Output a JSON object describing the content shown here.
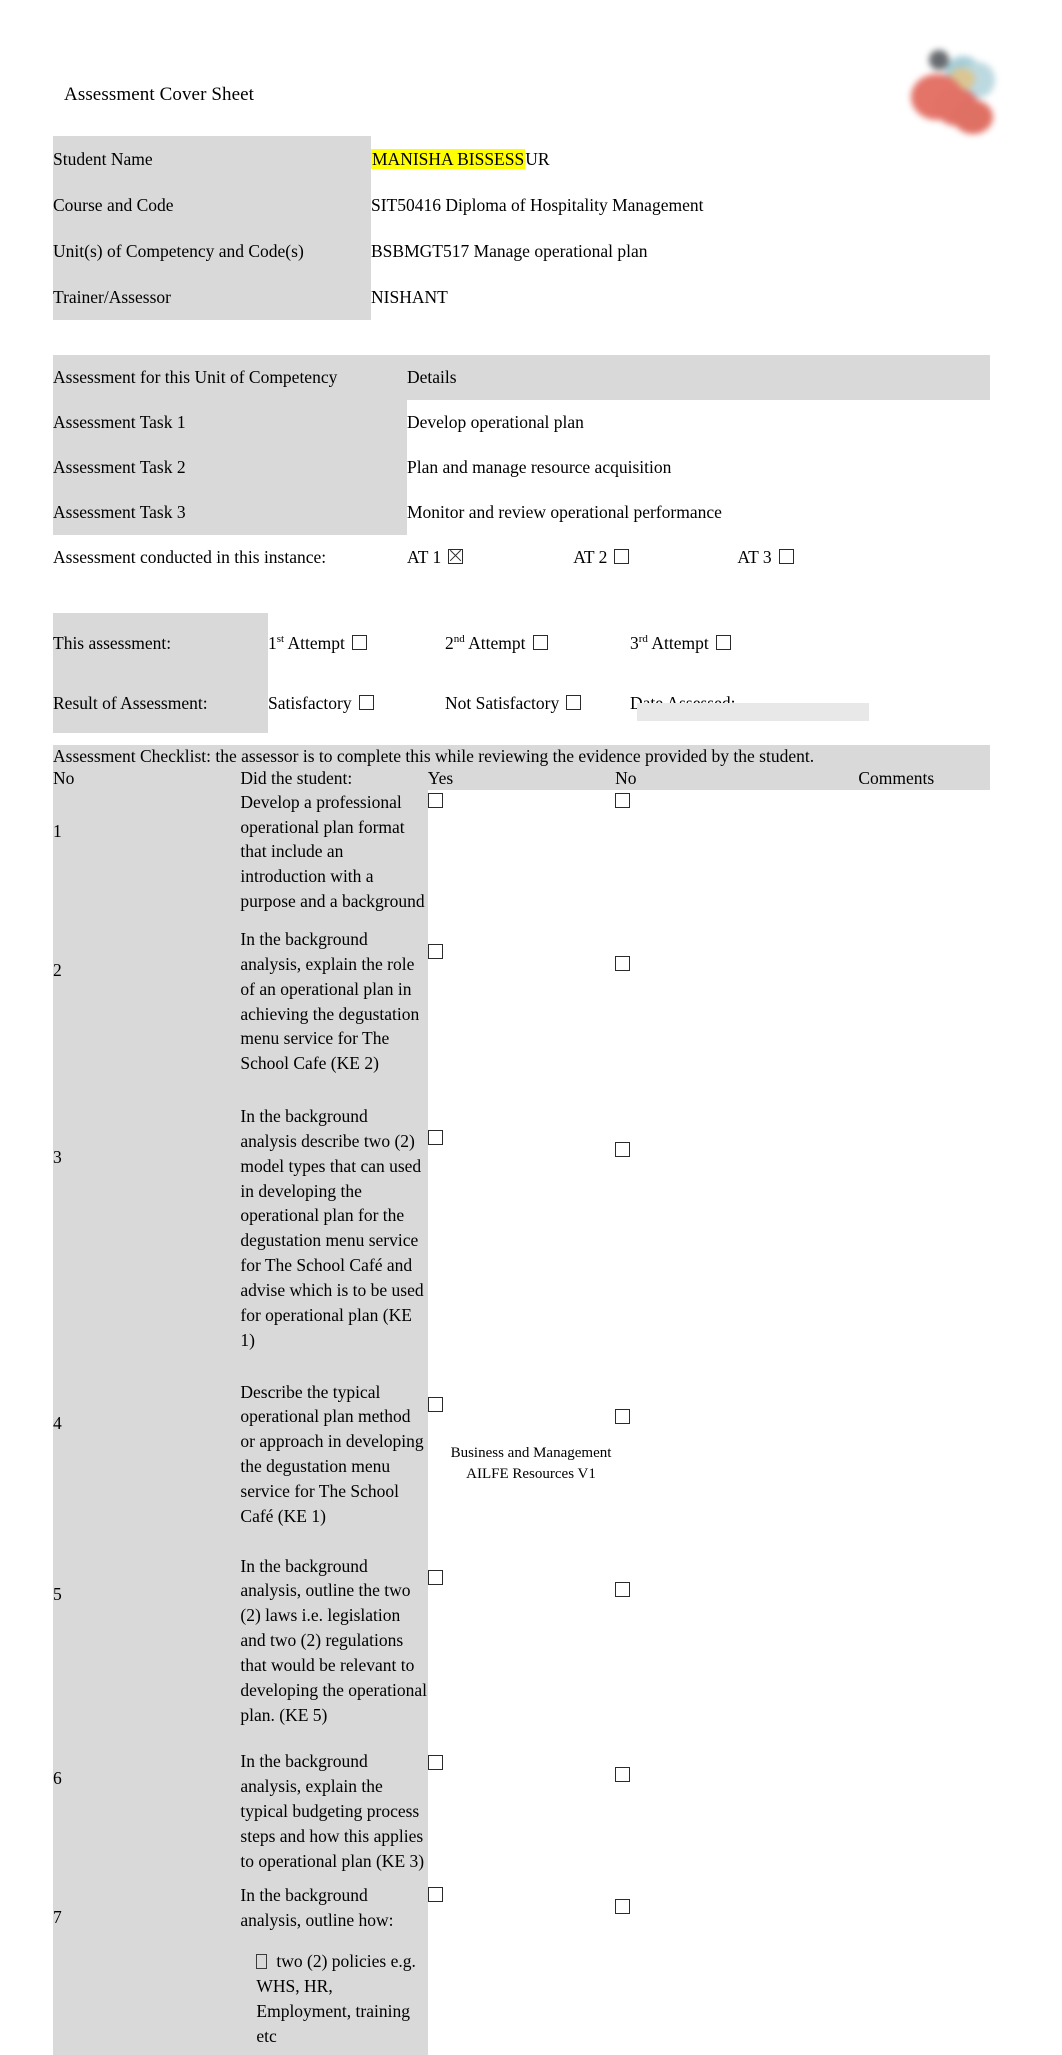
{
  "document": {
    "title": "Assessment Cover Sheet",
    "logo_name": "institute-logo"
  },
  "student_details": {
    "rows": [
      {
        "label": "Student Name",
        "value": "MANISHA BISSESSUR",
        "highlight": "MANISHA BISSESS",
        "highlight_tail": "UR"
      },
      {
        "label": "Course and Code",
        "value": "SIT50416 Diploma of Hospitality Management"
      },
      {
        "label": "Unit(s) of Competency and Code(s)",
        "value": "BSBMGT517 Manage operational plan"
      },
      {
        "label": "Trainer/Assessor",
        "value": "NISHANT"
      }
    ]
  },
  "assessment_tasks": {
    "header_left": "Assessment for this Unit of Competency",
    "header_right": "Details",
    "rows": [
      {
        "label": "Assessment Task 1",
        "detail": "Develop operational plan"
      },
      {
        "label": "Assessment Task 2",
        "detail": "Plan and manage resource acquisition"
      },
      {
        "label": "Assessment Task 3",
        "detail": "Monitor and review operational performance"
      }
    ],
    "conducted_label": "Assessment conducted in this instance:",
    "conducted_options": [
      {
        "label": "AT 1",
        "checked": true
      },
      {
        "label": "AT 2",
        "checked": false
      },
      {
        "label": "AT 3",
        "checked": false
      }
    ]
  },
  "attempt_result": {
    "this_assessment_label": "This assessment:",
    "attempts": [
      {
        "number": "1",
        "ordinal": "st",
        "label": "Attempt",
        "checked": false
      },
      {
        "number": "2",
        "ordinal": "nd",
        "label": "Attempt",
        "checked": false
      },
      {
        "number": "3",
        "ordinal": "rd",
        "label": "Attempt",
        "checked": false
      }
    ],
    "result_label": "Result of Assessment:",
    "results": [
      {
        "label": "Satisfactory",
        "checked": false
      },
      {
        "label": "Not Satisfactory",
        "checked": false
      }
    ],
    "date_assessed_label": "Date Assessed:",
    "date_assessed_value": ""
  },
  "checklist": {
    "banner": "Assessment Checklist: the assessor is to complete this while reviewing the evidence provided by the student.",
    "columns": {
      "no": "No",
      "question": "Did the student:",
      "yes": "Yes",
      "no_col": "No",
      "comments": "Comments"
    },
    "rows": [
      {
        "no": "1",
        "text": "Develop  a professional operational plan format that include an introduction with a purpose and a background",
        "yes_checked": false,
        "no_checked": false,
        "comment": ""
      },
      {
        "no": "2",
        "text": "In the background analysis, explain the role of an operational plan in achieving the degustation menu service for The School Cafe (KE 2)",
        "yes_checked": false,
        "no_checked": false,
        "comment": ""
      },
      {
        "no": "3",
        "text": "In the background analysis describe two (2) model types that can used in developing the operational plan for the degustation menu service for The School Café and advise which is to be used for operational plan (KE 1)",
        "yes_checked": false,
        "no_checked": false,
        "comment": ""
      },
      {
        "no": "4",
        "text": "Describe the typical operational plan method or approach in developing the degustation menu service for The School Café (KE 1)",
        "yes_checked": false,
        "no_checked": false,
        "comment": ""
      },
      {
        "no": "5",
        "text": "In the background analysis, outline the two (2) laws i.e. legislation and two (2) regulations that would be relevant to developing the operational plan. (KE 5)",
        "yes_checked": false,
        "no_checked": false,
        "comment": ""
      },
      {
        "no": "6",
        "text": "In the background analysis, explain the typical budgeting process steps and how this applies to operational plan (KE 3)",
        "yes_checked": false,
        "no_checked": false,
        "comment": ""
      },
      {
        "no": "7",
        "text": "In the background analysis, outline how:",
        "bullet": "two (2) policies e.g. WHS, HR, Employment, training etc",
        "yes_checked": false,
        "no_checked": false,
        "comment": ""
      }
    ]
  },
  "footer": {
    "line1": "Business and Management",
    "line2": "AILFE Resources V1"
  },
  "colors": {
    "shade": "#d9d9d9",
    "highlight": "#ffff00",
    "text": "#000000"
  }
}
